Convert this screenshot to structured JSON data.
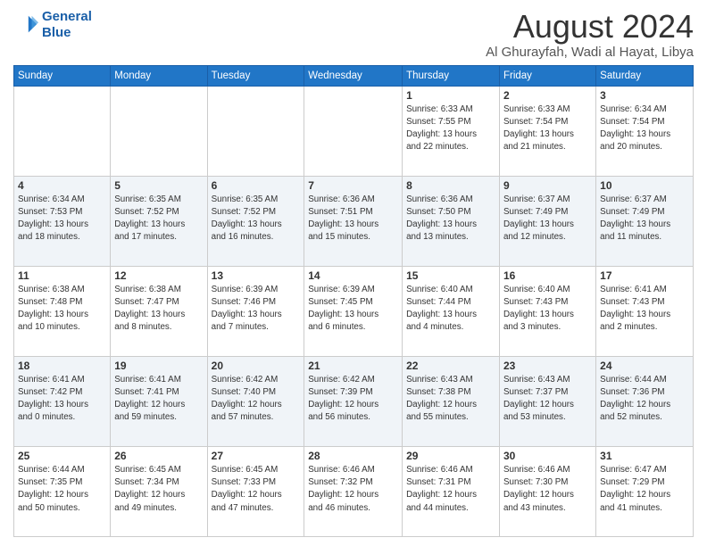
{
  "logo": {
    "line1": "General",
    "line2": "Blue"
  },
  "title": "August 2024",
  "subtitle": "Al Ghurayfah, Wadi al Hayat, Libya",
  "days_of_week": [
    "Sunday",
    "Monday",
    "Tuesday",
    "Wednesday",
    "Thursday",
    "Friday",
    "Saturday"
  ],
  "weeks": [
    [
      {
        "day": "",
        "info": ""
      },
      {
        "day": "",
        "info": ""
      },
      {
        "day": "",
        "info": ""
      },
      {
        "day": "",
        "info": ""
      },
      {
        "day": "1",
        "info": "Sunrise: 6:33 AM\nSunset: 7:55 PM\nDaylight: 13 hours\nand 22 minutes."
      },
      {
        "day": "2",
        "info": "Sunrise: 6:33 AM\nSunset: 7:54 PM\nDaylight: 13 hours\nand 21 minutes."
      },
      {
        "day": "3",
        "info": "Sunrise: 6:34 AM\nSunset: 7:54 PM\nDaylight: 13 hours\nand 20 minutes."
      }
    ],
    [
      {
        "day": "4",
        "info": "Sunrise: 6:34 AM\nSunset: 7:53 PM\nDaylight: 13 hours\nand 18 minutes."
      },
      {
        "day": "5",
        "info": "Sunrise: 6:35 AM\nSunset: 7:52 PM\nDaylight: 13 hours\nand 17 minutes."
      },
      {
        "day": "6",
        "info": "Sunrise: 6:35 AM\nSunset: 7:52 PM\nDaylight: 13 hours\nand 16 minutes."
      },
      {
        "day": "7",
        "info": "Sunrise: 6:36 AM\nSunset: 7:51 PM\nDaylight: 13 hours\nand 15 minutes."
      },
      {
        "day": "8",
        "info": "Sunrise: 6:36 AM\nSunset: 7:50 PM\nDaylight: 13 hours\nand 13 minutes."
      },
      {
        "day": "9",
        "info": "Sunrise: 6:37 AM\nSunset: 7:49 PM\nDaylight: 13 hours\nand 12 minutes."
      },
      {
        "day": "10",
        "info": "Sunrise: 6:37 AM\nSunset: 7:49 PM\nDaylight: 13 hours\nand 11 minutes."
      }
    ],
    [
      {
        "day": "11",
        "info": "Sunrise: 6:38 AM\nSunset: 7:48 PM\nDaylight: 13 hours\nand 10 minutes."
      },
      {
        "day": "12",
        "info": "Sunrise: 6:38 AM\nSunset: 7:47 PM\nDaylight: 13 hours\nand 8 minutes."
      },
      {
        "day": "13",
        "info": "Sunrise: 6:39 AM\nSunset: 7:46 PM\nDaylight: 13 hours\nand 7 minutes."
      },
      {
        "day": "14",
        "info": "Sunrise: 6:39 AM\nSunset: 7:45 PM\nDaylight: 13 hours\nand 6 minutes."
      },
      {
        "day": "15",
        "info": "Sunrise: 6:40 AM\nSunset: 7:44 PM\nDaylight: 13 hours\nand 4 minutes."
      },
      {
        "day": "16",
        "info": "Sunrise: 6:40 AM\nSunset: 7:43 PM\nDaylight: 13 hours\nand 3 minutes."
      },
      {
        "day": "17",
        "info": "Sunrise: 6:41 AM\nSunset: 7:43 PM\nDaylight: 13 hours\nand 2 minutes."
      }
    ],
    [
      {
        "day": "18",
        "info": "Sunrise: 6:41 AM\nSunset: 7:42 PM\nDaylight: 13 hours\nand 0 minutes."
      },
      {
        "day": "19",
        "info": "Sunrise: 6:41 AM\nSunset: 7:41 PM\nDaylight: 12 hours\nand 59 minutes."
      },
      {
        "day": "20",
        "info": "Sunrise: 6:42 AM\nSunset: 7:40 PM\nDaylight: 12 hours\nand 57 minutes."
      },
      {
        "day": "21",
        "info": "Sunrise: 6:42 AM\nSunset: 7:39 PM\nDaylight: 12 hours\nand 56 minutes."
      },
      {
        "day": "22",
        "info": "Sunrise: 6:43 AM\nSunset: 7:38 PM\nDaylight: 12 hours\nand 55 minutes."
      },
      {
        "day": "23",
        "info": "Sunrise: 6:43 AM\nSunset: 7:37 PM\nDaylight: 12 hours\nand 53 minutes."
      },
      {
        "day": "24",
        "info": "Sunrise: 6:44 AM\nSunset: 7:36 PM\nDaylight: 12 hours\nand 52 minutes."
      }
    ],
    [
      {
        "day": "25",
        "info": "Sunrise: 6:44 AM\nSunset: 7:35 PM\nDaylight: 12 hours\nand 50 minutes."
      },
      {
        "day": "26",
        "info": "Sunrise: 6:45 AM\nSunset: 7:34 PM\nDaylight: 12 hours\nand 49 minutes."
      },
      {
        "day": "27",
        "info": "Sunrise: 6:45 AM\nSunset: 7:33 PM\nDaylight: 12 hours\nand 47 minutes."
      },
      {
        "day": "28",
        "info": "Sunrise: 6:46 AM\nSunset: 7:32 PM\nDaylight: 12 hours\nand 46 minutes."
      },
      {
        "day": "29",
        "info": "Sunrise: 6:46 AM\nSunset: 7:31 PM\nDaylight: 12 hours\nand 44 minutes."
      },
      {
        "day": "30",
        "info": "Sunrise: 6:46 AM\nSunset: 7:30 PM\nDaylight: 12 hours\nand 43 minutes."
      },
      {
        "day": "31",
        "info": "Sunrise: 6:47 AM\nSunset: 7:29 PM\nDaylight: 12 hours\nand 41 minutes."
      }
    ]
  ]
}
